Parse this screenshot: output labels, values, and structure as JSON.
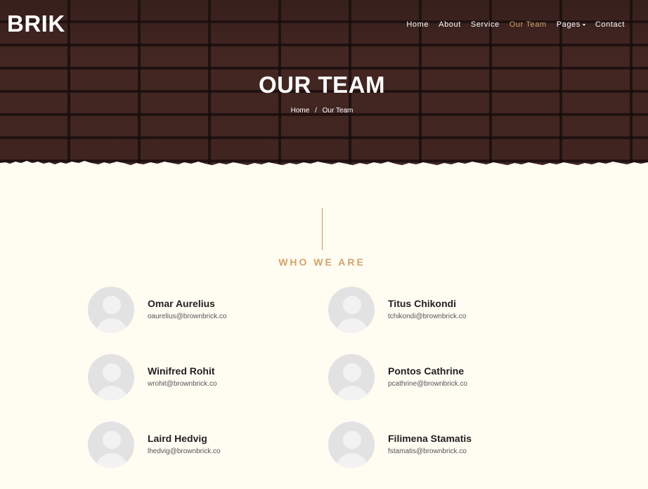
{
  "header": {
    "logo": "BRIK",
    "nav": [
      {
        "label": "Home",
        "active": false
      },
      {
        "label": "About",
        "active": false
      },
      {
        "label": "Service",
        "active": false
      },
      {
        "label": "Our Team",
        "active": true
      },
      {
        "label": "Pages",
        "active": false,
        "has_dropdown": true
      },
      {
        "label": "Contact",
        "active": false
      }
    ]
  },
  "hero": {
    "title": "OUR TEAM",
    "breadcrumb": {
      "home": "Home",
      "separator": "/",
      "current": "Our Team"
    }
  },
  "section": {
    "title": "WHO WE ARE"
  },
  "team": [
    {
      "name": "Omar Aurelius",
      "email": "oaurelius@brownbrick.co"
    },
    {
      "name": "Titus Chikondi",
      "email": "tchikondi@brownbrick.co"
    },
    {
      "name": "Winifred Rohit",
      "email": "wrohit@brownbrick.co"
    },
    {
      "name": "Pontos Cathrine",
      "email": "pcathrine@brownbrick.co"
    },
    {
      "name": "Laird Hedvig",
      "email": "lhedvig@brownbrick.co"
    },
    {
      "name": "Filimena Stamatis",
      "email": "fstamatis@brownbrick.co"
    }
  ],
  "colors": {
    "accent": "#d2a36c",
    "background": "#fffcf2",
    "hero_brick": "#3f2420",
    "avatar_placeholder": "#e2e2e2"
  }
}
